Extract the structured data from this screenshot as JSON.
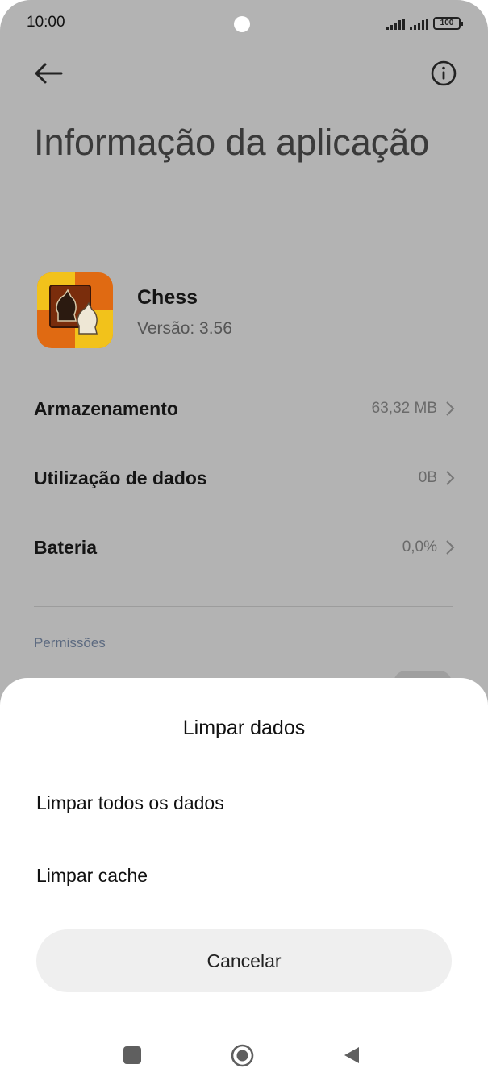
{
  "status": {
    "time": "10:00",
    "battery": "100"
  },
  "header": {
    "title": "Informação da aplicação"
  },
  "app": {
    "name": "Chess",
    "version": "Versão: 3.56"
  },
  "rows": [
    {
      "label": "Armazenamento",
      "value": "63,32 MB"
    },
    {
      "label": "Utilização de dados",
      "value": "0B"
    },
    {
      "label": "Bateria",
      "value": "0,0%"
    }
  ],
  "permissions": {
    "section_label": "Permissões"
  },
  "sheet": {
    "title": "Limpar dados",
    "options": [
      {
        "label": "Limpar todos os dados"
      },
      {
        "label": "Limpar cache"
      }
    ],
    "cancel_label": "Cancelar"
  },
  "icons": {
    "back": "back-arrow-icon",
    "info": "info-icon",
    "chevron": "chevron-right-icon",
    "nav_recents": "square-icon",
    "nav_home": "circle-icon",
    "nav_back": "triangle-back-icon"
  },
  "colors": {
    "dim_background": "#b3b3b3",
    "sheet_background": "#ffffff",
    "cancel_background": "#efefef",
    "app_icon_orange": "#e06a12",
    "app_icon_yellow": "#f2c21b"
  }
}
